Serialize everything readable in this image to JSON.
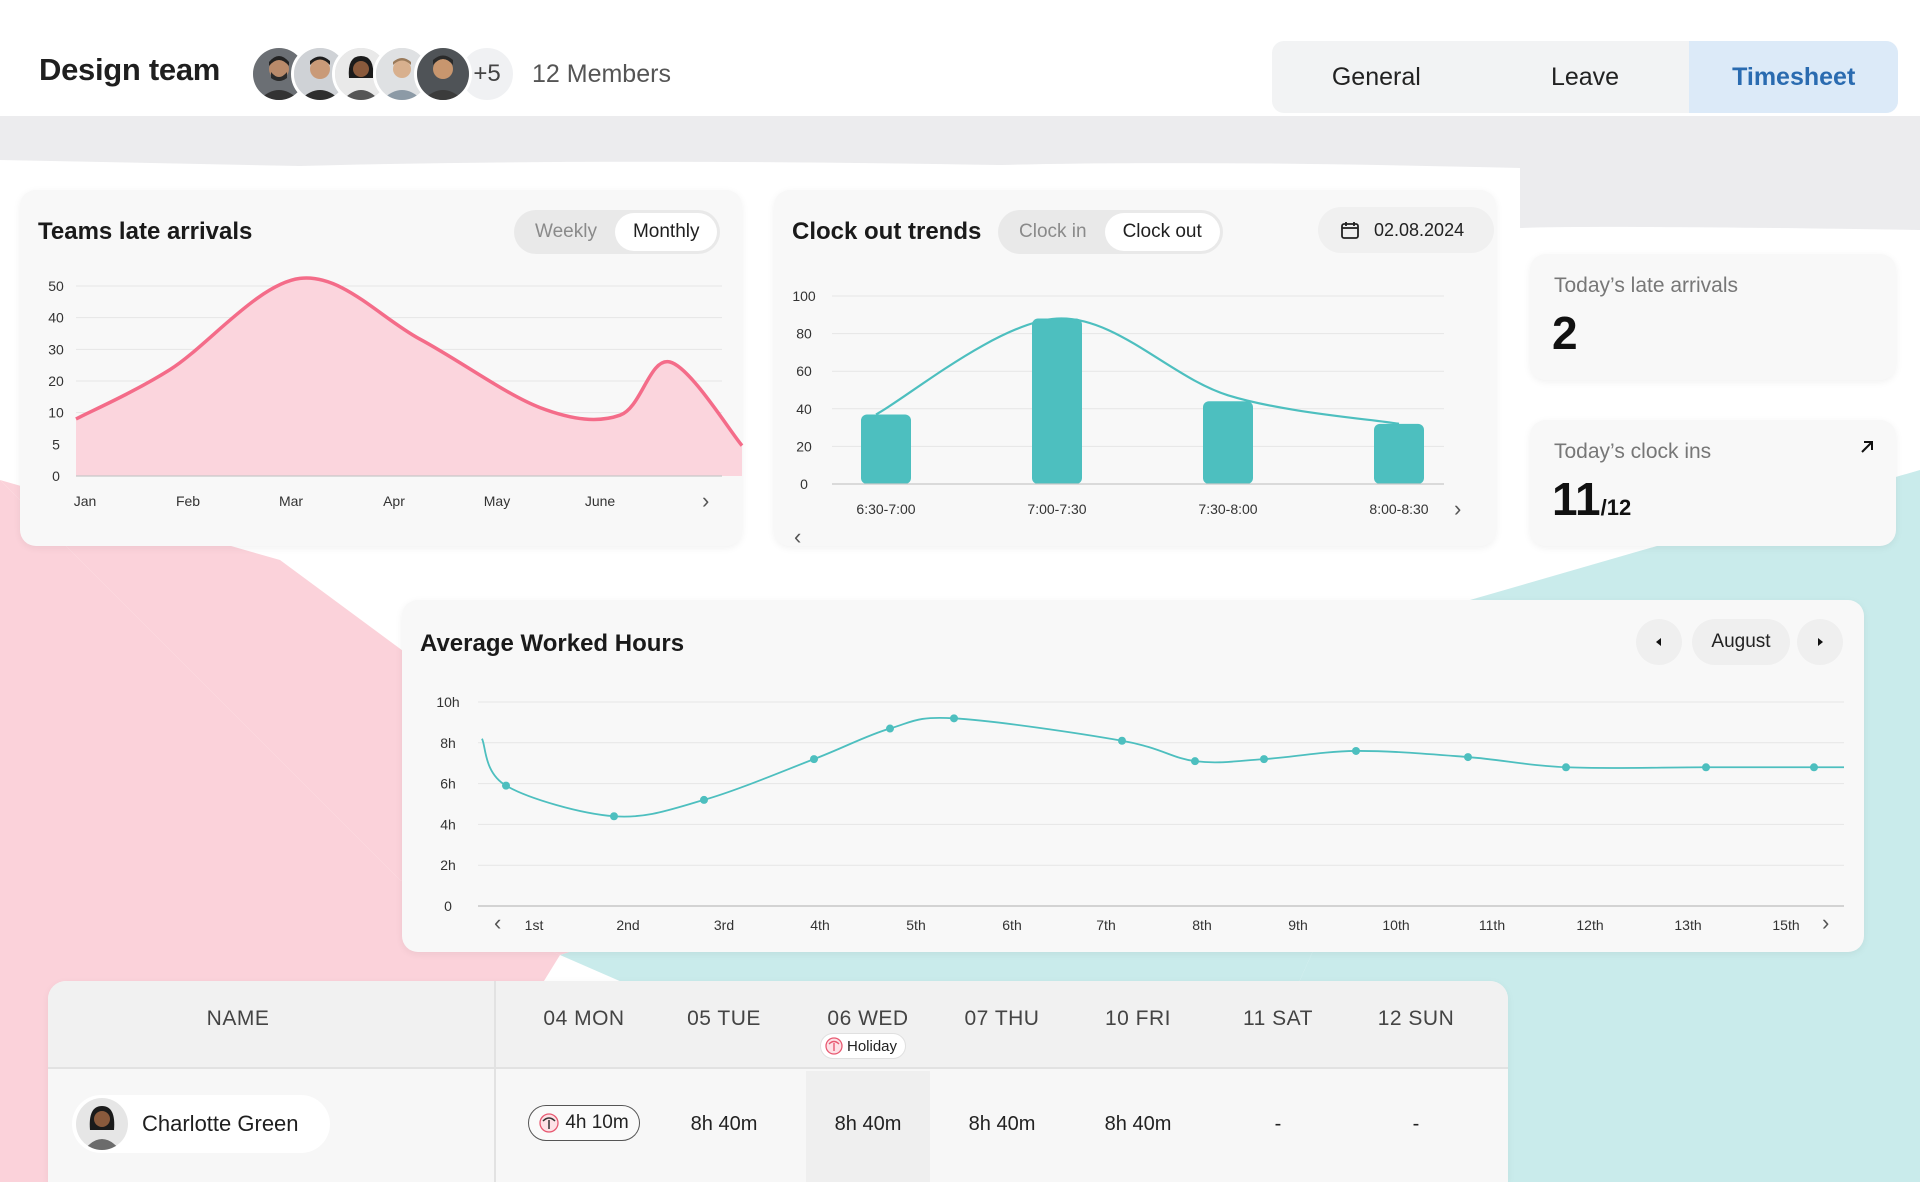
{
  "header": {
    "team_title": "Design team",
    "avatar_more": "+5",
    "members": "12 Members",
    "tabs": [
      {
        "label": "General",
        "active": false
      },
      {
        "label": "Leave",
        "active": false
      },
      {
        "label": "Timesheet",
        "active": true
      }
    ]
  },
  "late_arrivals_card": {
    "title": "Teams late arrivals",
    "toggle": [
      "Weekly",
      "Monthly"
    ],
    "active_toggle": "Monthly",
    "next_icon": "chevron-right-icon"
  },
  "clock_out_card": {
    "title": "Clock out trends",
    "toggle": [
      "Clock in",
      "Clock out"
    ],
    "active_toggle": "Clock out",
    "date": "02.08.2024",
    "date_icon": "calendar-icon"
  },
  "stats": {
    "late_label": "Today’s late arrivals",
    "late_value": "2",
    "clockins_label": "Today’s clock ins",
    "clockins_value": "11",
    "clockins_total": "/12"
  },
  "worked_hours_card": {
    "title": "Average Worked Hours",
    "month": "August"
  },
  "table": {
    "headers": [
      "NAME",
      "04 MON",
      "05 TUE",
      "06 WED",
      "07 THU",
      "10 FRI",
      "11 SAT",
      "12 SUN"
    ],
    "holiday_label": "Holiday",
    "rows": [
      {
        "name": "Charlotte Green",
        "cells": [
          "4h 10m",
          "8h 40m",
          "8h 40m",
          "8h 40m",
          "8h 40m",
          "-",
          "-"
        ]
      }
    ]
  },
  "colors": {
    "pink": "#f46c89",
    "pink_fill": "#fbd5dd",
    "teal": "#4dbfbf",
    "tab_active_bg": "#dceaf8",
    "tab_active_text": "#2a6bb0"
  },
  "chart_data": [
    {
      "type": "area",
      "title": "Teams late arrivals",
      "categories": [
        "Jan",
        "Feb",
        "Mar",
        "Apr",
        "May",
        "June"
      ],
      "y_ticks": [
        "0",
        "5",
        "10",
        "20",
        "30",
        "40",
        "50"
      ],
      "series": [
        {
          "values": [
            15,
            28,
            52,
            36,
            18,
            16,
            30,
            8
          ]
        }
      ],
      "ylim": [
        0,
        50
      ]
    },
    {
      "type": "bar",
      "title": "Clock out trends",
      "categories": [
        "6:30-7:00",
        "7:00-7:30",
        "7:30-8:00",
        "8:00-8:30"
      ],
      "values": [
        37,
        88,
        44,
        32
      ],
      "y_ticks": [
        "0",
        "20",
        "40",
        "60",
        "80",
        "100"
      ],
      "ylim": [
        0,
        100
      ]
    },
    {
      "type": "line",
      "title": "Average Worked Hours",
      "categories": [
        "1st",
        "2nd",
        "3rd",
        "4th",
        "5th",
        "6th",
        "7th",
        "8th",
        "9th",
        "10th",
        "11th",
        "12th",
        "13th",
        "15th"
      ],
      "y_ticks": [
        "0",
        "2h",
        "4h",
        "6h",
        "8h",
        "10h"
      ],
      "values": [
        8.2,
        5.9,
        4.4,
        5.2,
        7.2,
        8.7,
        9.2,
        8.1,
        7.1,
        7.2,
        7.6,
        7.3,
        6.8,
        6.8,
        6.8
      ],
      "ylim": [
        0,
        10
      ]
    }
  ]
}
